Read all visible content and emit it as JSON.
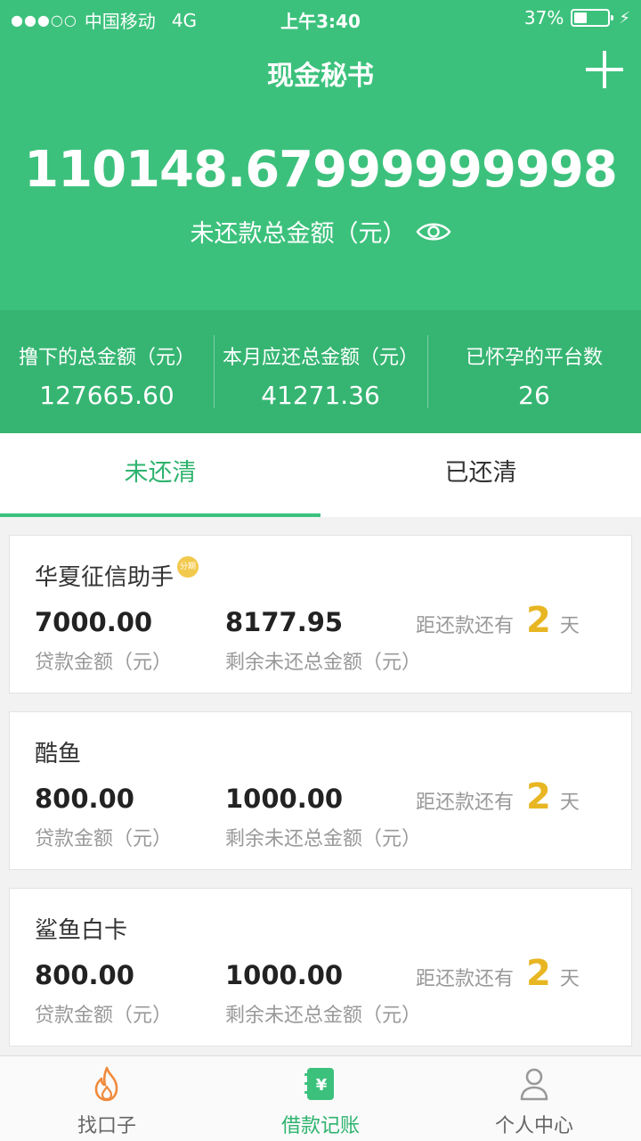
{
  "status_bar": {
    "signal": "●●●○○",
    "carrier": "中国移动",
    "network": "4G",
    "time": "上午3:40",
    "battery": "37%",
    "battery_level": 0.37
  },
  "header": {
    "title": "现金秘书",
    "total_unpaid": "110148.67999999998",
    "total_unpaid_label": "未还款总金额（元）"
  },
  "stats": [
    {
      "label": "撸下的总金额（元）",
      "value": "127665.60"
    },
    {
      "label": "本月应还总金额（元）",
      "value": "41271.36"
    },
    {
      "label": "已怀孕的平台数",
      "value": "26"
    }
  ],
  "tabs": [
    {
      "label": "未还清",
      "active": true
    },
    {
      "label": "已还清",
      "active": false
    }
  ],
  "loans": [
    {
      "name": "华夏征信助手",
      "badge": "分期",
      "loan_amount": "7000.00",
      "loan_label": "贷款金额（元）",
      "remaining": "8177.95",
      "remaining_label": "剩余未还总金额（元）",
      "due_prefix": "距还款还有",
      "due_days": "2",
      "due_unit": "天"
    },
    {
      "name": "酷鱼",
      "loan_amount": "800.00",
      "loan_label": "贷款金额（元）",
      "remaining": "1000.00",
      "remaining_label": "剩余未还总金额（元）",
      "due_prefix": "距还款还有",
      "due_days": "2",
      "due_unit": "天"
    },
    {
      "name": "鲨鱼白卡",
      "loan_amount": "800.00",
      "loan_label": "贷款金额（元）",
      "remaining": "1000.00",
      "remaining_label": "剩余未还总金额（元）",
      "due_prefix": "距还款还有",
      "due_days": "2",
      "due_unit": "天"
    }
  ],
  "bottom_nav": [
    {
      "label": "找口子",
      "icon": "flame-icon",
      "active": false
    },
    {
      "label": "借款记账",
      "icon": "ledger-yuan-icon",
      "active": true
    },
    {
      "label": "个人中心",
      "icon": "person-icon",
      "active": false
    }
  ],
  "colors": {
    "primary": "#3cc17c",
    "primary_dark": "#36b572",
    "accent_yellow": "#e8b623",
    "flame_orange": "#f08a3c"
  }
}
